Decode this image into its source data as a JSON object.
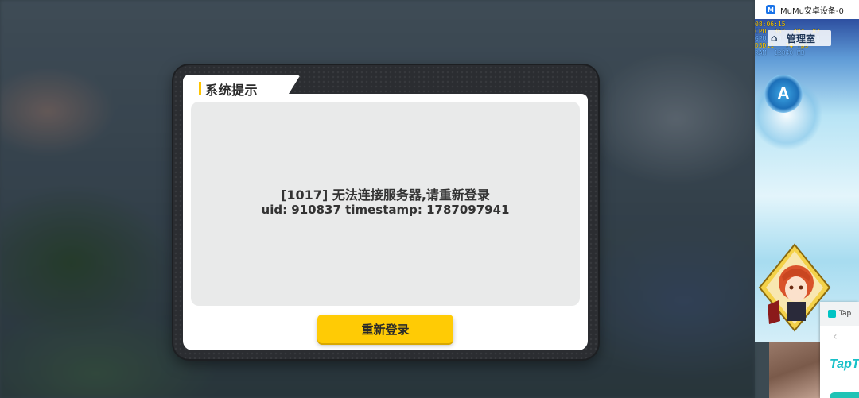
{
  "dialog": {
    "title": "系统提示",
    "message_line1": "[1017] 无法连接服务器,请重新登录",
    "message_line2": "uid: 910837 timestamp: 1787097941",
    "button_label": "重新登录"
  },
  "side_window": {
    "title": "MuMu安卓设备-0",
    "hud_line1": "08:06:15",
    "hud_line2": "CPU  36°  49°  82",
    "hud_line3": "GPU  19°  46°  38",
    "hud_line4": "D3D11   74 fps",
    "hud_line5": "RAM  12840 MB",
    "room_label": "管理室",
    "emblem_letter": "A"
  },
  "taptap": {
    "header_text": "Tap",
    "logo": "TapT"
  },
  "colors": {
    "accent": "#ffcb05",
    "tab_marker": "#ffc400",
    "dialog_frame": "#2b2d31",
    "message_bg": "#e9eaea",
    "taptap_brand": "#17c0c8"
  },
  "icons": {
    "mumu": "mumu-app-icon",
    "home": "home-icon",
    "back": "chevron-left-icon"
  }
}
